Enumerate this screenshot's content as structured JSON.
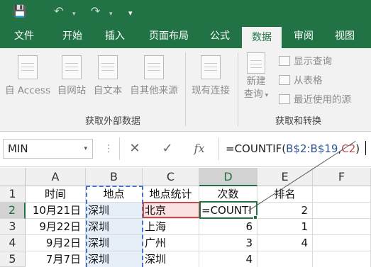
{
  "colors": {
    "brand_green": "#217346",
    "ref_blue": "#4472c4",
    "ref_red": "#c0504d"
  },
  "qat": {
    "save_icon": "floppy-disk-icon",
    "undo_icon": "undo-icon",
    "redo_icon": "redo-icon",
    "customize_icon": "customize-qat-icon"
  },
  "tabs": [
    {
      "label": "文件"
    },
    {
      "label": "开始"
    },
    {
      "label": "插入"
    },
    {
      "label": "页面布局"
    },
    {
      "label": "公式"
    },
    {
      "label": "数据",
      "active": true
    },
    {
      "label": "审阅"
    },
    {
      "label": "视图"
    }
  ],
  "ribbon": {
    "external": {
      "from_access": "自 Access",
      "from_web": "自网站",
      "from_text": "自文本",
      "from_other": "自其他来源",
      "existing": "现有连接",
      "group_label": "获取外部数据"
    },
    "transform": {
      "new_query_line1": "新建",
      "new_query_line2": "查询",
      "show_queries": "显示查询",
      "from_table": "从表格",
      "recent_sources": "最近使用的源",
      "group_label": "获取和转换"
    }
  },
  "formula_bar": {
    "name_box": "MIN",
    "cancel_symbol": "✕",
    "enter_symbol": "✓",
    "fx_label": "fx",
    "formula_prefix": "=COUNTIF(",
    "formula_ref1": "B$2:B$19",
    "formula_comma": ",",
    "formula_ref2": "C2",
    "formula_suffix": ")"
  },
  "sheet": {
    "columns": [
      "A",
      "B",
      "C",
      "D",
      "E",
      "F"
    ],
    "rows": [
      "1",
      "2",
      "3",
      "4",
      "5"
    ],
    "header_row": [
      "时间",
      "地点",
      "地点统计",
      "次数",
      "排名",
      ""
    ],
    "data": [
      [
        "10月21日",
        "深圳",
        "北京",
        "=COUNTI",
        "2",
        ""
      ],
      [
        "9月22日",
        "深圳",
        "上海",
        "6",
        "1",
        ""
      ],
      [
        "9月2日",
        "深圳",
        "广州",
        "3",
        "4",
        ""
      ],
      [
        "7月7日",
        "深圳",
        "深圳",
        "4",
        "",
        ""
      ]
    ]
  }
}
